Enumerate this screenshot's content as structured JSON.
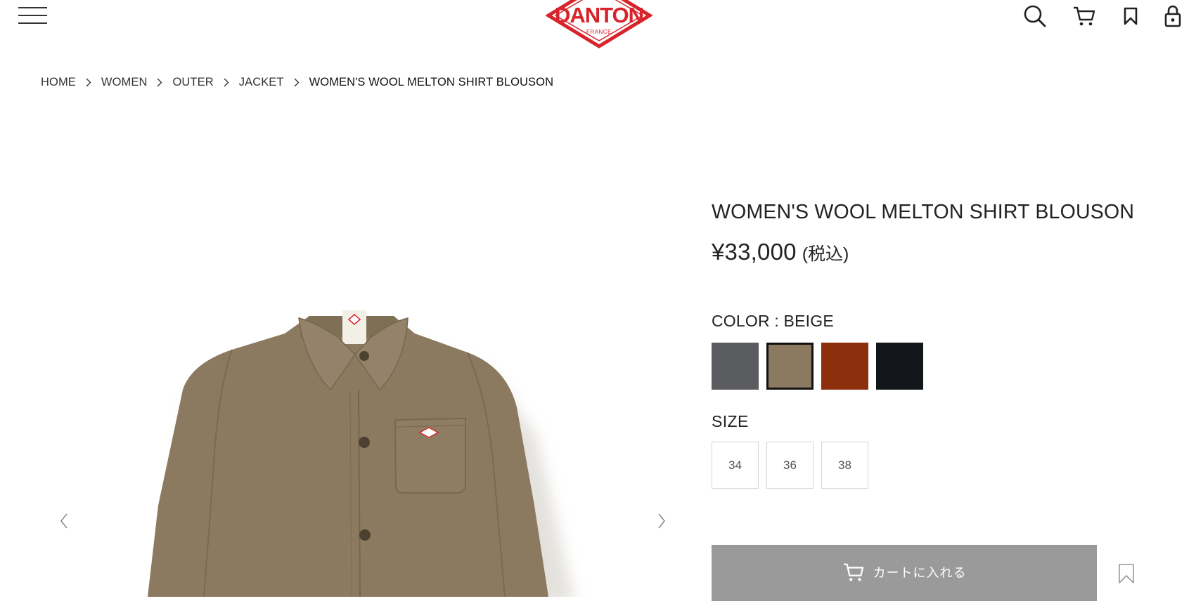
{
  "header": {
    "logo_text": "DANTON",
    "logo_sub": "FRANCE",
    "icons": [
      "menu-icon",
      "search-icon",
      "cart-icon",
      "bookmark-icon",
      "lock-icon"
    ]
  },
  "breadcrumb": {
    "items": [
      "HOME",
      "WOMEN",
      "OUTER",
      "JACKET"
    ],
    "current": "WOMEN'S WOOL MELTON SHIRT BLOUSON"
  },
  "product": {
    "title": "WOMEN'S WOOL MELTON SHIRT BLOUSON",
    "price": "¥33,000",
    "price_tax_note": "(税込)",
    "color_label": "COLOR : BEIGE",
    "swatches": [
      {
        "name": "gray",
        "color": "#5b5c5f",
        "selected": false
      },
      {
        "name": "beige",
        "color": "#8b7a5f",
        "selected": true
      },
      {
        "name": "rust",
        "color": "#8c2f0c",
        "selected": false
      },
      {
        "name": "black",
        "color": "#121519",
        "selected": false
      }
    ],
    "size_label": "SIZE",
    "sizes": [
      "34",
      "36",
      "38"
    ],
    "cart_button": "カートに入れる"
  },
  "colors": {
    "brand_red": "#d8232a",
    "jacket": "#8b7a5f",
    "cart_button_bg": "#9a9a9a"
  }
}
